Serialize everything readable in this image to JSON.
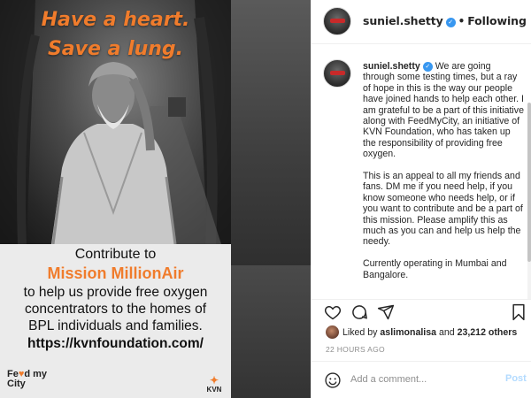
{
  "post_image": {
    "headline_line1": "Have a heart.",
    "headline_line2": "Save a lung.",
    "contribute": "Contribute to",
    "mission": "Mission MillionAir",
    "body_line1": "to help us provide free oxygen",
    "body_line2": "concentrators to the homes of",
    "body_line3": "BPL individuals and families.",
    "url": "https://kvnfoundation.com/",
    "logo_feedmycity_1": "Fe",
    "logo_feedmycity_heart": "♥",
    "logo_feedmycity_2": "d my",
    "logo_feedmycity_3": "City",
    "logo_kvn": "KVN",
    "accent_color": "#f07c2c"
  },
  "header": {
    "username": "suniel.shetty",
    "verified_icon": "verified-badge-icon",
    "separator": "•",
    "follow_status": "Following"
  },
  "caption": {
    "username": "suniel.shetty",
    "paragraph1": "We are going through some testing times, but a ray of hope in this is the way our people have joined hands to help each other. I am grateful to be a part of this initiative along with FeedMyCity, an initiative of KVN Foundation, who has taken up the responsibility of providing free oxygen.",
    "paragraph2": "This is an appeal to all my friends and fans. DM me if you need help, if you know someone who needs help, or if you want to contribute and be a part of this mission. Please amplify this as much as you can and help us help the needy.",
    "paragraph3": "Currently operating in Mumbai and Bangalore."
  },
  "actions": {
    "icons": [
      "heart-icon",
      "comment-icon",
      "share-icon",
      "bookmark-icon"
    ]
  },
  "likes": {
    "prefix": "Liked by ",
    "first_user": "aslimonalisa",
    "middle": " and ",
    "others": "23,212 others"
  },
  "timestamp": "22 HOURS AGO",
  "comment_bar": {
    "placeholder": "Add a comment...",
    "post_label": "Post",
    "post_color": "#b3dbff"
  },
  "colors": {
    "verified": "#3897f0",
    "text": "#262626",
    "muted": "#8e8e8e"
  }
}
